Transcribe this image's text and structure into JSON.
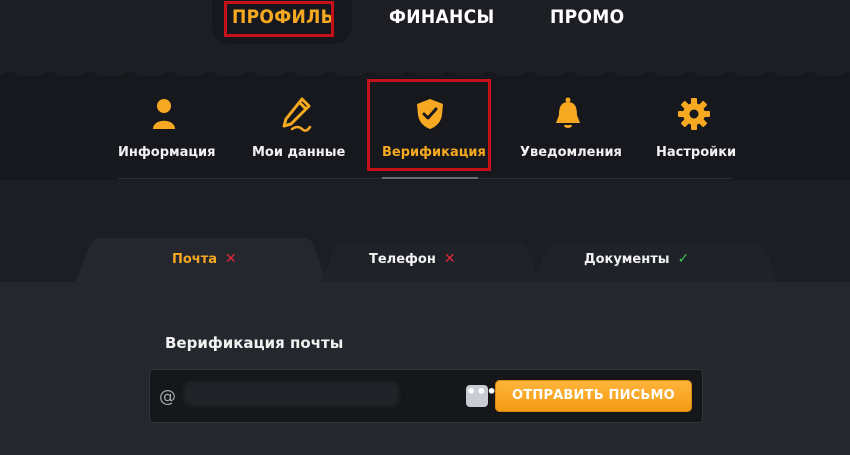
{
  "top_tabs": [
    {
      "label": "ПРОФИЛЬ",
      "active": true
    },
    {
      "label": "ФИНАНСЫ",
      "active": false
    },
    {
      "label": "ПРОМО",
      "active": false
    }
  ],
  "nav_items": [
    {
      "label": "Информация",
      "icon": "user-icon",
      "active": false
    },
    {
      "label": "Мои данные",
      "icon": "pencil-icon",
      "active": false
    },
    {
      "label": "Верификация",
      "icon": "shield-check-icon",
      "active": true
    },
    {
      "label": "Уведомления",
      "icon": "bell-icon",
      "active": false
    },
    {
      "label": "Настройки",
      "icon": "gear-icon",
      "active": false
    }
  ],
  "verification_tabs": [
    {
      "label": "Почта",
      "status": "✕",
      "active": true
    },
    {
      "label": "Телефон",
      "status": "✕",
      "active": false
    },
    {
      "label": "Документы",
      "status": "✓",
      "active": false
    }
  ],
  "email_section": {
    "title": "Верификация почты",
    "prefix": "@",
    "dots_label": "•••",
    "send_button": "ОТПРАВИТЬ ПИСЬМО"
  },
  "colors": {
    "accent": "#f6a821",
    "highlight_box": "#c6111b",
    "error": "#e3263b",
    "success": "#3ec34b"
  }
}
